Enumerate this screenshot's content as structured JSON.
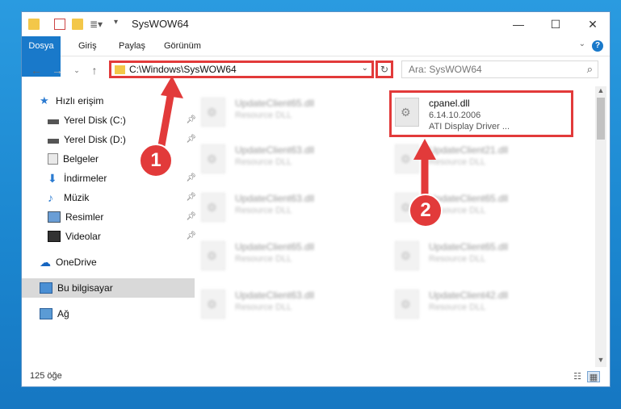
{
  "window": {
    "title": "SysWOW64"
  },
  "ribbon": {
    "tabs": [
      "Dosya",
      "Giriş",
      "Paylaş",
      "Görünüm"
    ],
    "help": "?"
  },
  "nav": {
    "address": "C:\\Windows\\SysWOW64",
    "search_placeholder": "Ara: SysWOW64"
  },
  "sidebar": {
    "items": [
      {
        "label": "Hızlı erişim",
        "icon": "star-icon"
      },
      {
        "label": "Yerel Disk (C:)",
        "icon": "drive-icon"
      },
      {
        "label": "Yerel Disk (D:)",
        "icon": "drive-icon"
      },
      {
        "label": "Belgeler",
        "icon": "documents-icon"
      },
      {
        "label": "İndirmeler",
        "icon": "download-icon"
      },
      {
        "label": "Müzik",
        "icon": "music-icon"
      },
      {
        "label": "Resimler",
        "icon": "pictures-icon"
      },
      {
        "label": "Videolar",
        "icon": "video-icon"
      },
      {
        "label": "OneDrive",
        "icon": "cloud-icon"
      },
      {
        "label": "Bu bilgisayar",
        "icon": "computer-icon"
      },
      {
        "label": "Ağ",
        "icon": "network-icon"
      }
    ]
  },
  "files": [
    {
      "name": "UpdateClient65.dll",
      "desc": "Resource DLL"
    },
    {
      "name": "cpanel.dll",
      "desc": "6.14.10.2006",
      "desc2": "ATI Display Driver ..."
    },
    {
      "name": "UpdateClient63.dll",
      "desc": "Resource DLL"
    },
    {
      "name": "UpdateClient21.dll",
      "desc": "Resource DLL"
    },
    {
      "name": "UpdateClient63.dll",
      "desc": "Resource DLL"
    },
    {
      "name": "UpdateClient65.dll",
      "desc": "Resource DLL"
    },
    {
      "name": "UpdateClient65.dll",
      "desc": "Resource DLL"
    },
    {
      "name": "UpdateClient65.dll",
      "desc": "Resource DLL"
    },
    {
      "name": "UpdateClient63.dll",
      "desc": "Resource DLL"
    },
    {
      "name": "UpdateClient42.dll",
      "desc": "Resource DLL"
    }
  ],
  "status": {
    "count": "125 öğe"
  },
  "annotations": {
    "step1": "1",
    "step2": "2",
    "color": "#e23a3a"
  }
}
